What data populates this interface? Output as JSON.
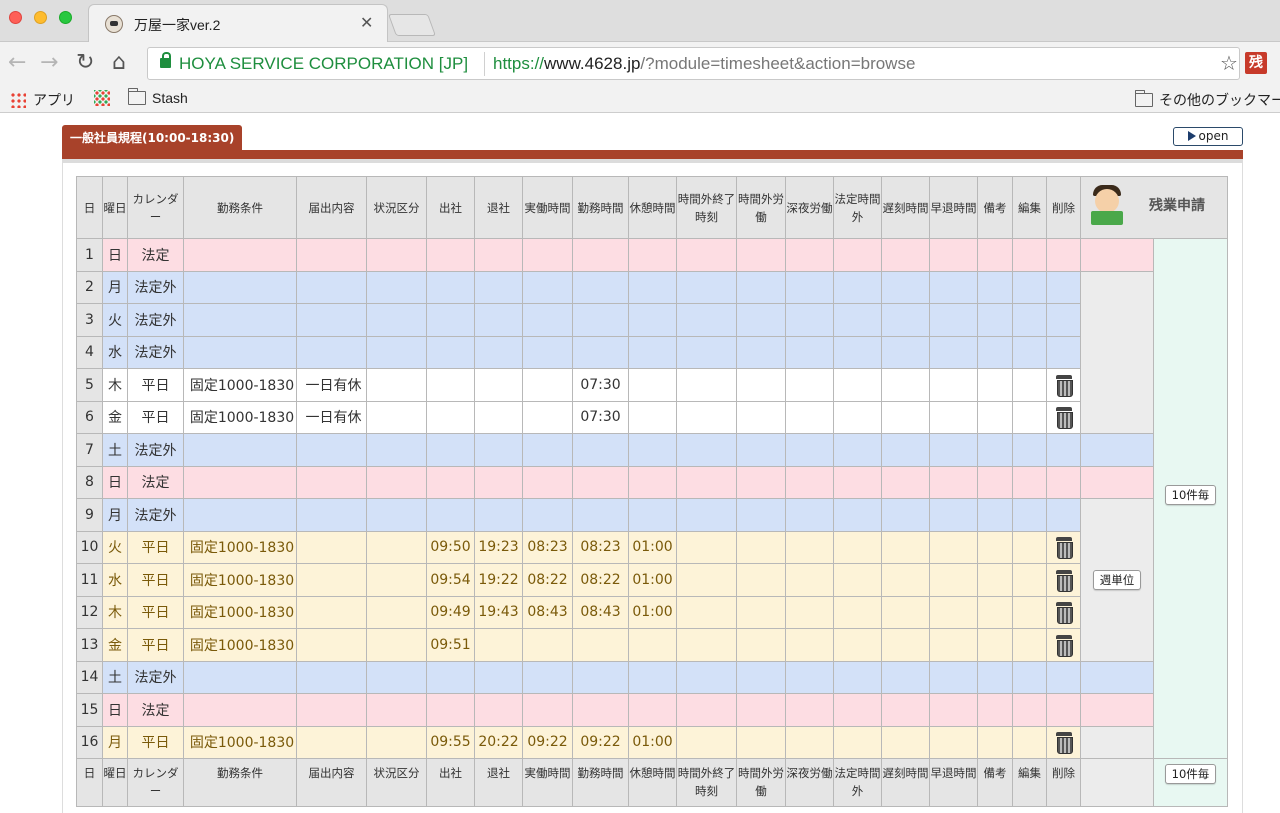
{
  "browser": {
    "tab_title": "万屋一家ver.2",
    "ev_name": "HOYA SERVICE CORPORATION [JP]",
    "url_scheme": "https://",
    "url_host": "www.4628.jp",
    "url_path": "/?module=timesheet&action=browse",
    "extension_label": "残",
    "bookmarks": {
      "apps": "アプリ",
      "stash": "Stash",
      "other": "その他のブックマーク"
    }
  },
  "page": {
    "section_tab": "一般社員規程(10:00-18:30)",
    "open_button": "open",
    "weekly_button": "週単位",
    "pager_button_1": "10件毎",
    "pager_button_2": "10件毎",
    "zangyo_label": "残業申請"
  },
  "table": {
    "headers": [
      "日",
      "曜日",
      "カレンダー",
      "勤務条件",
      "届出内容",
      "状況区分",
      "出社",
      "退社",
      "実働時間",
      "勤務時間",
      "休憩時間",
      "時間外終了時刻",
      "時間外労働",
      "深夜労働",
      "法定時間外",
      "遅刻時間",
      "早退時間",
      "備考",
      "編集",
      "削除"
    ],
    "rows": [
      {
        "d": "1",
        "w": "日",
        "cal": "法定",
        "cond": "",
        "notice": "",
        "in": "",
        "out": "",
        "act": "",
        "work": "",
        "rest": ""
      },
      {
        "d": "2",
        "w": "月",
        "cal": "法定外",
        "cond": "",
        "notice": "",
        "in": "",
        "out": "",
        "act": "",
        "work": "",
        "rest": ""
      },
      {
        "d": "3",
        "w": "火",
        "cal": "法定外",
        "cond": "",
        "notice": "",
        "in": "",
        "out": "",
        "act": "",
        "work": "",
        "rest": ""
      },
      {
        "d": "4",
        "w": "水",
        "cal": "法定外",
        "cond": "",
        "notice": "",
        "in": "",
        "out": "",
        "act": "",
        "work": "",
        "rest": ""
      },
      {
        "d": "5",
        "w": "木",
        "cal": "平日",
        "cond": "固定1000-1830",
        "notice": "一日有休",
        "in": "",
        "out": "",
        "act": "",
        "work": "07:30",
        "rest": ""
      },
      {
        "d": "6",
        "w": "金",
        "cal": "平日",
        "cond": "固定1000-1830",
        "notice": "一日有休",
        "in": "",
        "out": "",
        "act": "",
        "work": "07:30",
        "rest": ""
      },
      {
        "d": "7",
        "w": "土",
        "cal": "法定外",
        "cond": "",
        "notice": "",
        "in": "",
        "out": "",
        "act": "",
        "work": "",
        "rest": ""
      },
      {
        "d": "8",
        "w": "日",
        "cal": "法定",
        "cond": "",
        "notice": "",
        "in": "",
        "out": "",
        "act": "",
        "work": "",
        "rest": ""
      },
      {
        "d": "9",
        "w": "月",
        "cal": "法定外",
        "cond": "",
        "notice": "",
        "in": "",
        "out": "",
        "act": "",
        "work": "",
        "rest": ""
      },
      {
        "d": "10",
        "w": "火",
        "cal": "平日",
        "cond": "固定1000-1830",
        "notice": "",
        "in": "09:50",
        "out": "19:23",
        "act": "08:23",
        "work": "08:23",
        "rest": "01:00"
      },
      {
        "d": "11",
        "w": "水",
        "cal": "平日",
        "cond": "固定1000-1830",
        "notice": "",
        "in": "09:54",
        "out": "19:22",
        "act": "08:22",
        "work": "08:22",
        "rest": "01:00"
      },
      {
        "d": "12",
        "w": "木",
        "cal": "平日",
        "cond": "固定1000-1830",
        "notice": "",
        "in": "09:49",
        "out": "19:43",
        "act": "08:43",
        "work": "08:43",
        "rest": "01:00"
      },
      {
        "d": "13",
        "w": "金",
        "cal": "平日",
        "cond": "固定1000-1830",
        "notice": "",
        "in": "09:51",
        "out": "",
        "act": "",
        "work": "",
        "rest": ""
      },
      {
        "d": "14",
        "w": "土",
        "cal": "法定外",
        "cond": "",
        "notice": "",
        "in": "",
        "out": "",
        "act": "",
        "work": "",
        "rest": ""
      },
      {
        "d": "15",
        "w": "日",
        "cal": "法定",
        "cond": "",
        "notice": "",
        "in": "",
        "out": "",
        "act": "",
        "work": "",
        "rest": ""
      },
      {
        "d": "16",
        "w": "月",
        "cal": "平日",
        "cond": "固定1000-1830",
        "notice": "",
        "in": "09:55",
        "out": "20:22",
        "act": "09:22",
        "work": "09:22",
        "rest": "01:00"
      }
    ]
  },
  "colors": {
    "accent": "#a8422a",
    "holiday_row": "#fddde3",
    "offday_row": "#d3e1f8",
    "workday_row": "#fdf3d8",
    "overtime_column": "#e8f8f2"
  }
}
